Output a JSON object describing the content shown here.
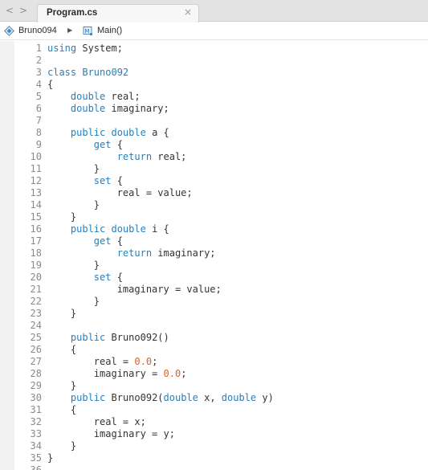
{
  "tab": {
    "title": "Program.cs",
    "close_glyph": "×"
  },
  "nav": {
    "back_glyph": "<",
    "forward_glyph": ">"
  },
  "breadcrumb": {
    "namespace": "Bruno094",
    "separator": "▶",
    "method": "Main()",
    "namespace_icon": "namespace-icon",
    "method_icon": "method-icon"
  },
  "colors": {
    "keyword": "#2a7fb8",
    "number": "#e0631d",
    "text": "#333333",
    "line_number": "#8a8a8a"
  },
  "editor": {
    "lines": [
      [
        [
          "using",
          "kw"
        ],
        [
          " System;",
          ""
        ]
      ],
      [],
      [
        [
          "class",
          "kw"
        ],
        [
          " ",
          ""
        ],
        [
          "Bruno092",
          "kw"
        ]
      ],
      [
        [
          "{",
          ""
        ]
      ],
      [
        [
          "    ",
          ""
        ],
        [
          "double",
          "kw"
        ],
        [
          " real;",
          ""
        ]
      ],
      [
        [
          "    ",
          ""
        ],
        [
          "double",
          "kw"
        ],
        [
          " imaginary;",
          ""
        ]
      ],
      [],
      [
        [
          "    ",
          ""
        ],
        [
          "public",
          "kw"
        ],
        [
          " ",
          ""
        ],
        [
          "double",
          "kw"
        ],
        [
          " a {",
          ""
        ]
      ],
      [
        [
          "        ",
          ""
        ],
        [
          "get",
          "kw"
        ],
        [
          " {",
          ""
        ]
      ],
      [
        [
          "            ",
          ""
        ],
        [
          "return",
          "kw"
        ],
        [
          " real;",
          ""
        ]
      ],
      [
        [
          "        }",
          ""
        ]
      ],
      [
        [
          "        ",
          ""
        ],
        [
          "set",
          "kw"
        ],
        [
          " {",
          ""
        ]
      ],
      [
        [
          "            real = value;",
          ""
        ]
      ],
      [
        [
          "        }",
          ""
        ]
      ],
      [
        [
          "    }",
          ""
        ]
      ],
      [
        [
          "    ",
          ""
        ],
        [
          "public",
          "kw"
        ],
        [
          " ",
          ""
        ],
        [
          "double",
          "kw"
        ],
        [
          " i {",
          ""
        ]
      ],
      [
        [
          "        ",
          ""
        ],
        [
          "get",
          "kw"
        ],
        [
          " {",
          ""
        ]
      ],
      [
        [
          "            ",
          ""
        ],
        [
          "return",
          "kw"
        ],
        [
          " imaginary;",
          ""
        ]
      ],
      [
        [
          "        }",
          ""
        ]
      ],
      [
        [
          "        ",
          ""
        ],
        [
          "set",
          "kw"
        ],
        [
          " {",
          ""
        ]
      ],
      [
        [
          "            imaginary = value;",
          ""
        ]
      ],
      [
        [
          "        }",
          ""
        ]
      ],
      [
        [
          "    }",
          ""
        ]
      ],
      [],
      [
        [
          "    ",
          ""
        ],
        [
          "public",
          "kw"
        ],
        [
          " Bruno092()",
          ""
        ]
      ],
      [
        [
          "    {",
          ""
        ]
      ],
      [
        [
          "        real = ",
          ""
        ],
        [
          "0.0",
          "num"
        ],
        [
          ";",
          ""
        ]
      ],
      [
        [
          "        imaginary = ",
          ""
        ],
        [
          "0.0",
          "num"
        ],
        [
          ";",
          ""
        ]
      ],
      [
        [
          "    }",
          ""
        ]
      ],
      [
        [
          "    ",
          ""
        ],
        [
          "public",
          "kw"
        ],
        [
          " Bruno092(",
          ""
        ],
        [
          "double",
          "kw"
        ],
        [
          " x, ",
          ""
        ],
        [
          "double",
          "kw"
        ],
        [
          " y)",
          ""
        ]
      ],
      [
        [
          "    {",
          ""
        ]
      ],
      [
        [
          "        real = x;",
          ""
        ]
      ],
      [
        [
          "        imaginary = y;",
          ""
        ]
      ],
      [
        [
          "    }",
          ""
        ]
      ],
      [
        [
          "}",
          ""
        ]
      ],
      []
    ]
  }
}
